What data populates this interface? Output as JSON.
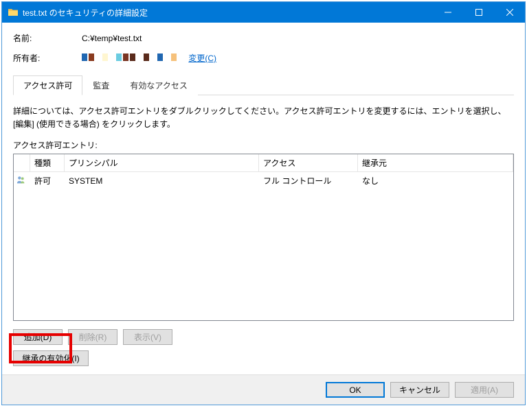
{
  "titlebar": {
    "title": "test.txt のセキュリティの詳細設定"
  },
  "name_label": "名前:",
  "name_value": "C:¥temp¥test.txt",
  "owner_label": "所有者:",
  "owner_colors": [
    "#2167b1",
    "#8a3b1f",
    "#ffffff",
    "#fff6d0",
    "#ffffff",
    "#6bcce1",
    "#7a3522",
    "#5a2b1c",
    "#ffffff",
    "#5a2b1c",
    "#ffffff",
    "#2167b1",
    "#ffffff",
    "#f6c17b"
  ],
  "change_link": "変更(C)",
  "tabs": {
    "permission": "アクセス許可",
    "audit": "監査",
    "effective": "有効なアクセス"
  },
  "description": "詳細については、アクセス許可エントリをダブルクリックしてください。アクセス許可エントリを変更するには、エントリを選択し、[編集] (使用できる場合) をクリックします。",
  "list_label": "アクセス許可エントリ:",
  "columns": {
    "type": "種類",
    "principal": "プリンシパル",
    "access": "アクセス",
    "inherit": "継承元"
  },
  "entries": [
    {
      "type": "許可",
      "principal": "SYSTEM",
      "access": "フル コントロール",
      "inherit": "なし"
    }
  ],
  "buttons": {
    "add": "追加(D)",
    "remove": "削除(R)",
    "view": "表示(V)",
    "enable_inherit": "継承の有効化(I)",
    "ok": "OK",
    "cancel": "キャンセル",
    "apply": "適用(A)"
  }
}
